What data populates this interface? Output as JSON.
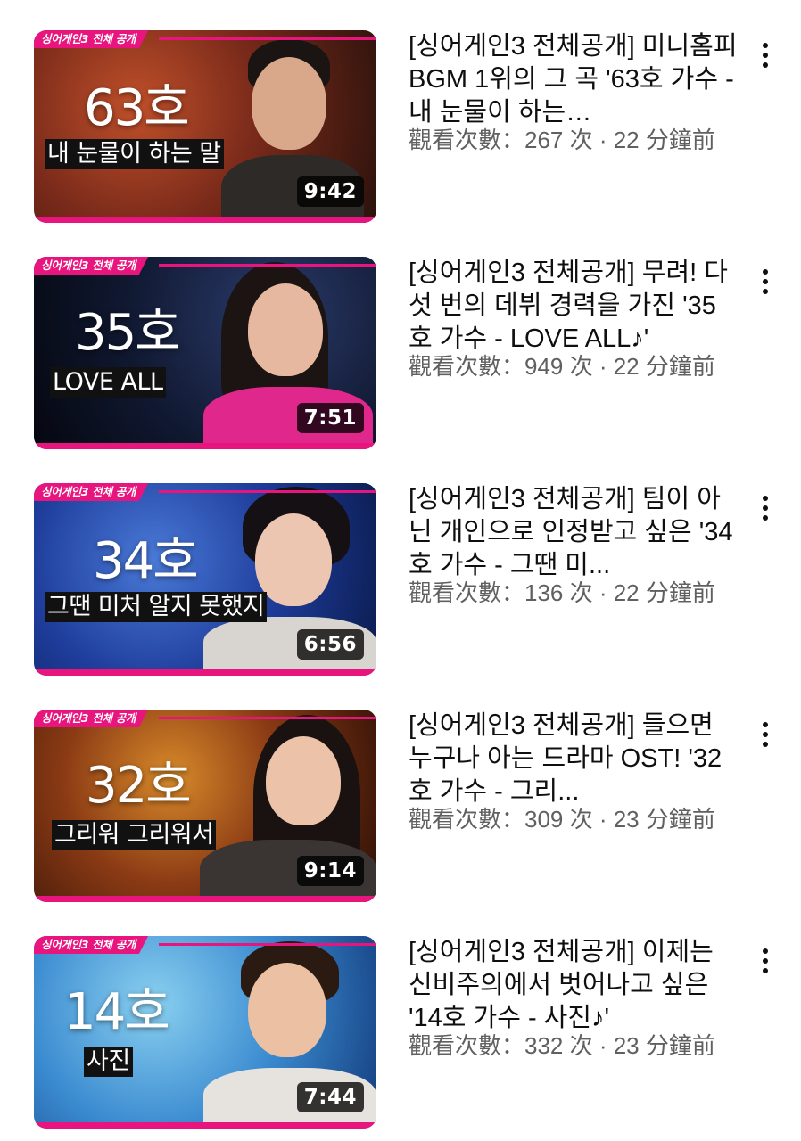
{
  "colors": {
    "accent": "#e8157f",
    "title_text": "#0f0f0f",
    "meta_text": "#606060"
  },
  "icons": {
    "more": "more-vert-icon"
  },
  "videos": [
    {
      "brand_tag": "싱어게인3 전체 공개",
      "contestant_no": "63호",
      "song_caption": "내 눈물이 하는 말",
      "duration": "9:42",
      "title": "[싱어게인3 전체공개] 미니홈피 BGM 1위의 그 곡 '63호 가수 - 내 눈물이 하는…",
      "meta": "觀看次數：267 次 · 22 分鐘前"
    },
    {
      "brand_tag": "싱어게인3 전체 공개",
      "contestant_no": "35호",
      "song_caption": "LOVE ALL",
      "duration": "7:51",
      "title": "[싱어게인3 전체공개] 무려! 다섯 번의 데뷔 경력을 가진 '35호 가수 - LOVE ALL♪'",
      "meta": "觀看次數：949 次 · 22 分鐘前"
    },
    {
      "brand_tag": "싱어게인3 전체 공개",
      "contestant_no": "34호",
      "song_caption": "그땐 미처 알지 못했지",
      "duration": "6:56",
      "title": "[싱어게인3 전체공개] 팀이 아닌 개인으로 인정받고 싶은 '34호 가수 - 그땐 미...",
      "meta": "觀看次數：136 次 · 22 分鐘前"
    },
    {
      "brand_tag": "싱어게인3 전체 공개",
      "contestant_no": "32호",
      "song_caption": "그리워 그리워서",
      "duration": "9:14",
      "title": "[싱어게인3 전체공개] 들으면 누구나 아는 드라마 OST! '32호 가수 - 그리...",
      "meta": "觀看次數：309 次 · 23 分鐘前"
    },
    {
      "brand_tag": "싱어게인3 전체 공개",
      "contestant_no": "14호",
      "song_caption": "사진",
      "duration": "7:44",
      "title": "[싱어게인3 전체공개] 이제는 신비주의에서 벗어나고 싶은 '14호 가수 - 사진♪'",
      "meta": "觀看次數：332 次 · 23 分鐘前"
    }
  ]
}
